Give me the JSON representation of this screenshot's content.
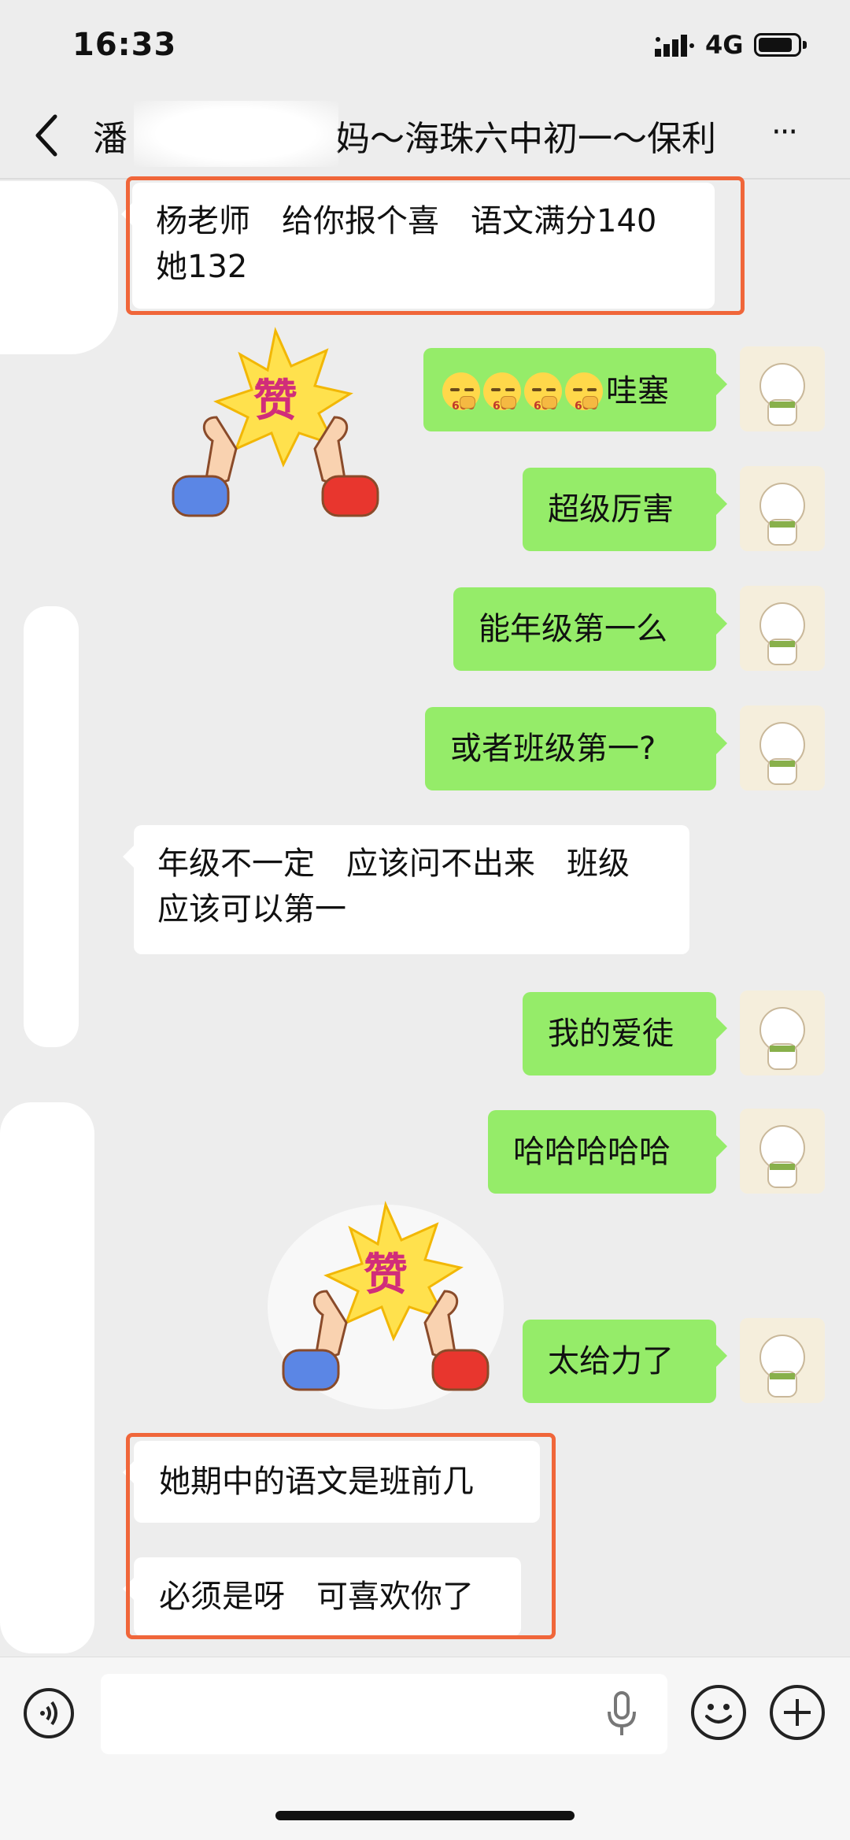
{
  "status": {
    "time": "16:33",
    "network": "4G"
  },
  "nav": {
    "title": "潘　　　　　　妈～海珠六中初一～保利",
    "more": "···"
  },
  "messages": [
    {
      "side": "in",
      "lines": [
        "杨老师　给你报个喜　语文满分140",
        "她132"
      ]
    },
    {
      "side": "out",
      "sticker_text": "赞"
    },
    {
      "side": "out",
      "text": "哇塞",
      "emoji_label": "666"
    },
    {
      "side": "out",
      "text": "超级厉害"
    },
    {
      "side": "out",
      "text": "能年级第一么"
    },
    {
      "side": "out",
      "text": "或者班级第一?"
    },
    {
      "side": "in",
      "lines": [
        "年级不一定　应该问不出来　班级",
        "应该可以第一"
      ]
    },
    {
      "side": "out",
      "text": "我的爱徒"
    },
    {
      "side": "out",
      "text": "哈哈哈哈哈"
    },
    {
      "side": "out",
      "text": "太给力了"
    },
    {
      "side": "in",
      "text": "她期中的语文是班前几"
    },
    {
      "side": "in",
      "text": "必须是呀　可喜欢你了"
    }
  ],
  "sticker": {
    "text": "赞"
  },
  "colors": {
    "bubble_out": "#95ec69",
    "bubble_in": "#ffffff",
    "highlight": "#f0663a",
    "background": "#ededed"
  },
  "icons": [
    "back-icon",
    "more-icon",
    "voice-icon",
    "mic-icon",
    "emoji-icon",
    "plus-icon"
  ]
}
